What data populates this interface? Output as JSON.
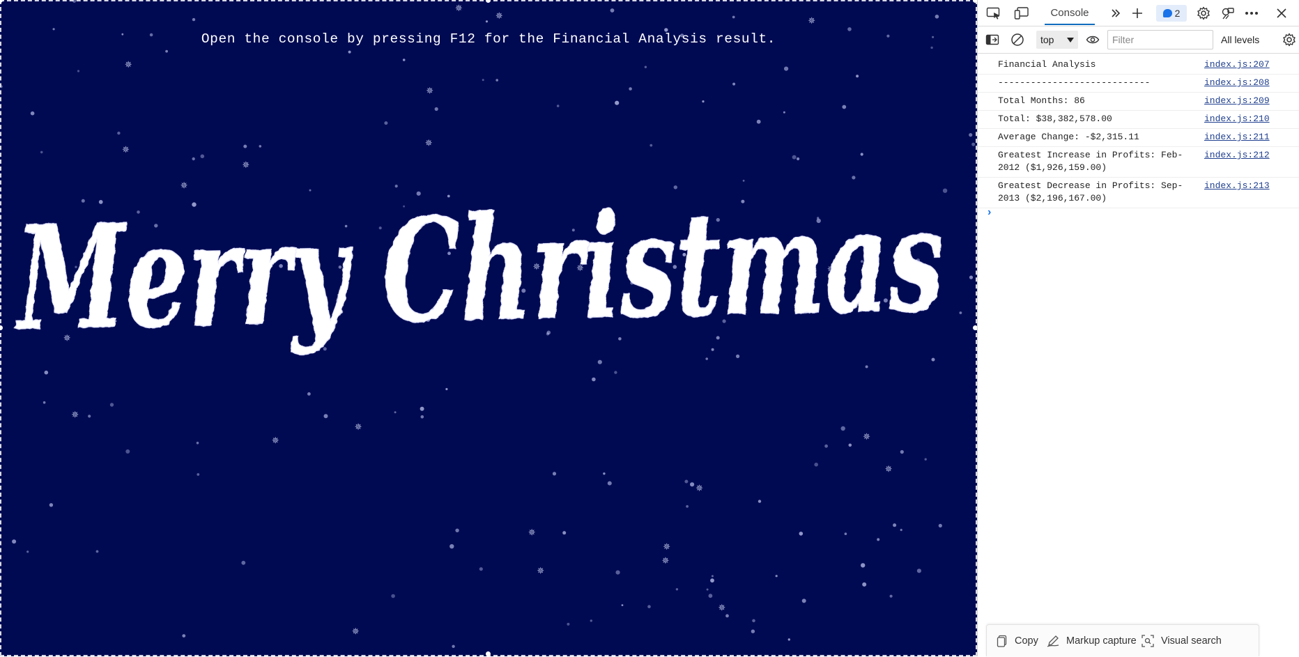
{
  "page": {
    "instruction": "Open the console by pressing F12 for the Financial Analysis result.",
    "greeting": "Merry Christmas",
    "background_color": "#000a52",
    "text_color": "#ffffff"
  },
  "devtools": {
    "tabs": {
      "inspect_icon": "inspect-element-icon",
      "device_icon": "device-emulation-icon",
      "active_tab": "Console",
      "more_tabs_icon": "double-chevron-right-icon",
      "add_tab_icon": "plus-icon",
      "issues_count": "2",
      "settings_icon": "gear-icon",
      "customize_icon": "customize-icon",
      "more_icon": "more-horizontal-icon",
      "close_icon": "close-icon"
    },
    "toolbar": {
      "context": "top",
      "filter_placeholder": "Filter",
      "levels": "All levels"
    },
    "log": [
      {
        "message": "Financial Analysis",
        "source": "index.js:207"
      },
      {
        "message": "----------------------------",
        "source": "index.js:208"
      },
      {
        "message": "Total Months: 86",
        "source": "index.js:209"
      },
      {
        "message": "Total: $38,382,578.00",
        "source": "index.js:210"
      },
      {
        "message": "Average Change: -$2,315.11",
        "source": "index.js:211"
      },
      {
        "message": "Greatest Increase in Profits: Feb-2012 ($1,926,159.00)",
        "source": "index.js:212"
      },
      {
        "message": "Greatest Decrease in Profits: Sep-2013 ($2,196,167.00)",
        "source": "index.js:213"
      }
    ],
    "bottom_bar": {
      "copy": "Copy",
      "markup": "Markup capture",
      "visual": "Visual search"
    },
    "accent_color": "#0f6cbd"
  }
}
